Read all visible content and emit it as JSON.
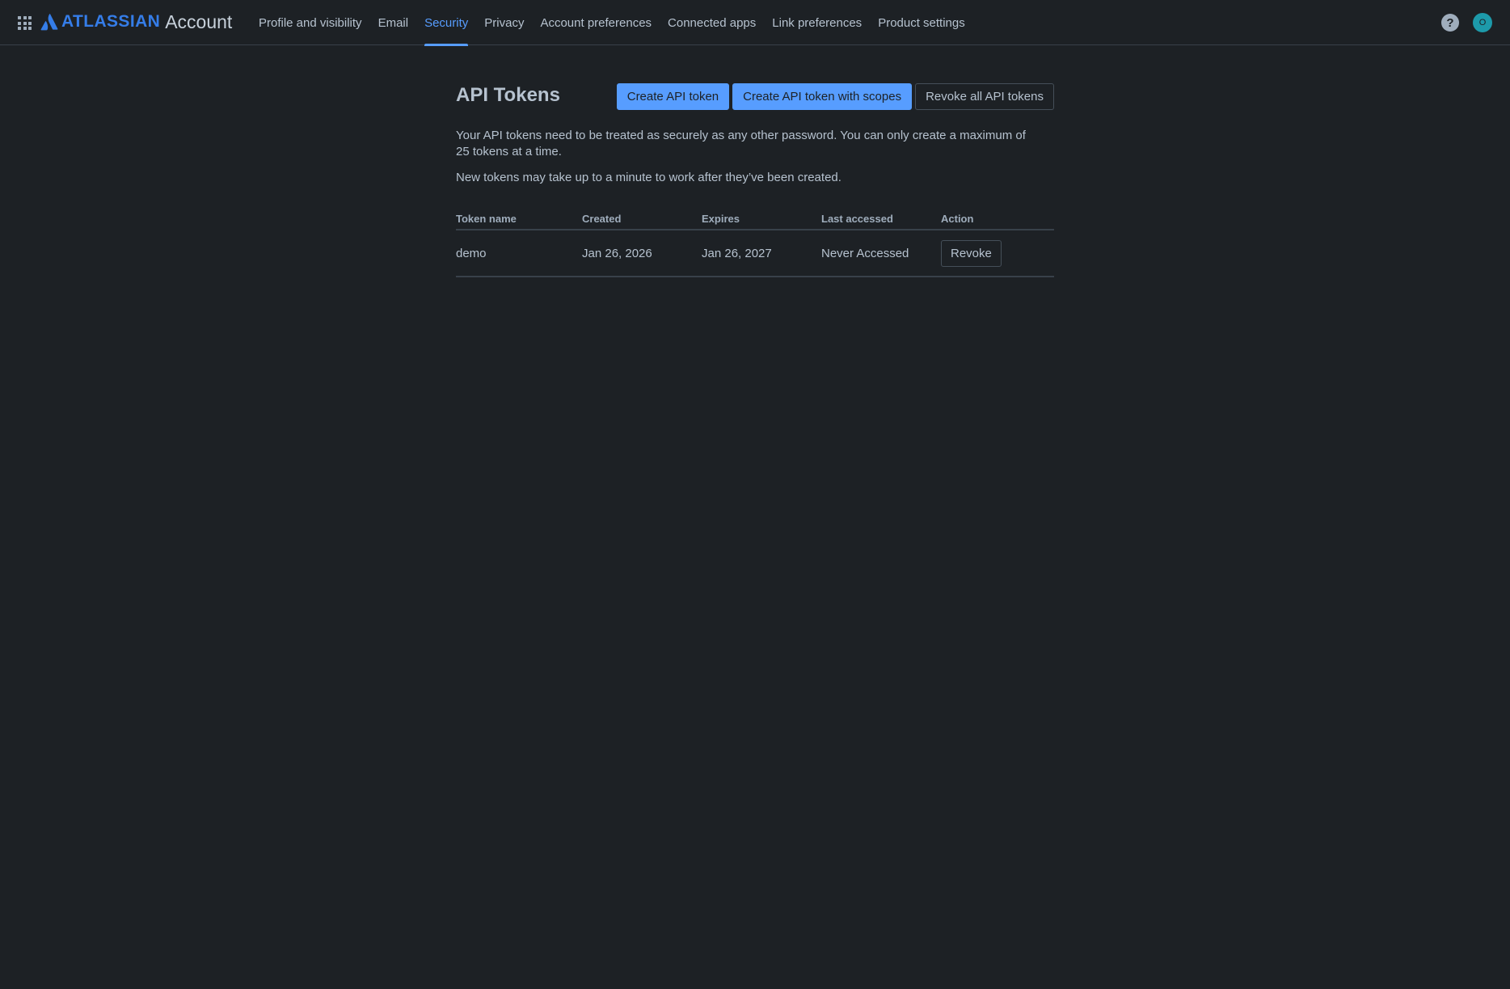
{
  "brand": {
    "wordmark": "ATLASSIAN",
    "product": "Account"
  },
  "nav": {
    "items": [
      {
        "label": "Profile and visibility",
        "active": false
      },
      {
        "label": "Email",
        "active": false
      },
      {
        "label": "Security",
        "active": true
      },
      {
        "label": "Privacy",
        "active": false
      },
      {
        "label": "Account preferences",
        "active": false
      },
      {
        "label": "Connected apps",
        "active": false
      },
      {
        "label": "Link preferences",
        "active": false
      },
      {
        "label": "Product settings",
        "active": false
      }
    ],
    "help_glyph": "?",
    "avatar_initial": "O"
  },
  "icons": {
    "app_switcher": "grid-icon",
    "logo": "atlassian-logo-icon",
    "help": "help-icon"
  },
  "colors": {
    "accent": "#579dff",
    "brand": "#357de8",
    "avatar": "#1d9aaa",
    "background": "#1d2125"
  },
  "page": {
    "title": "API Tokens",
    "actions": {
      "create": "Create API token",
      "create_scoped": "Create API token with scopes",
      "revoke_all": "Revoke all API tokens"
    },
    "description": "Your API tokens need to be treated as securely as any other password. You can only create a maximum of 25 tokens at a time.",
    "note": "New tokens may take up to a minute to work after they’ve been created."
  },
  "table": {
    "headers": {
      "name": "Token name",
      "created": "Created",
      "expires": "Expires",
      "last_accessed": "Last accessed",
      "action": "Action"
    },
    "rows": [
      {
        "name": "demo",
        "created": "Jan 26, 2026",
        "expires": "Jan 26, 2027",
        "last_accessed": "Never Accessed",
        "action": "Revoke"
      }
    ]
  }
}
